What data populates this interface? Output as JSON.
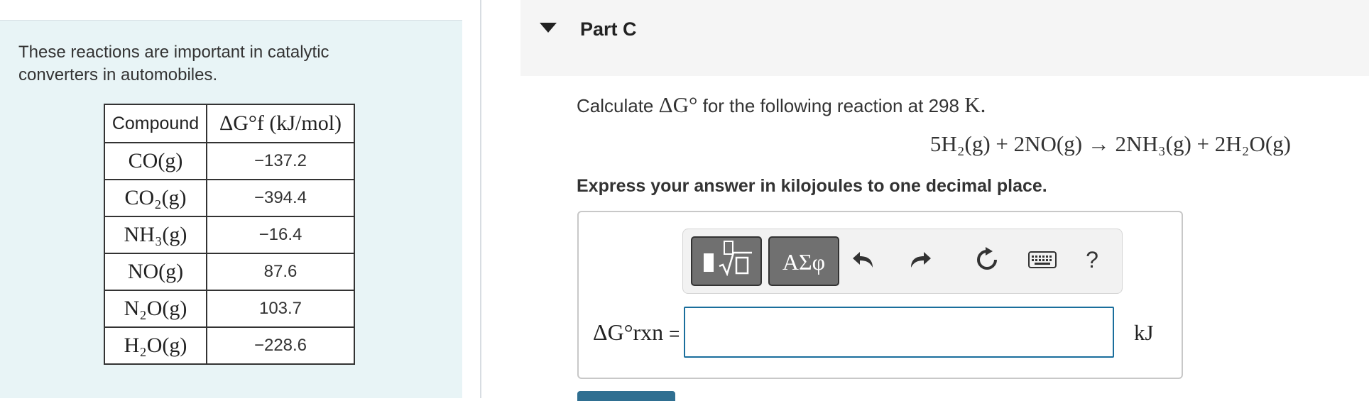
{
  "intro": {
    "line1": "These reactions are important in catalytic",
    "line2": "converters in automobiles."
  },
  "table": {
    "header_compound": "Compound",
    "header_dg": "ΔG°f (kJ/mol)",
    "rows": [
      {
        "compound": "CO(g)",
        "value": "−137.2"
      },
      {
        "compound": "CO₂(g)",
        "value": "−394.4"
      },
      {
        "compound": "NH₃(g)",
        "value": "−16.4"
      },
      {
        "compound": "NO(g)",
        "value": "87.6"
      },
      {
        "compound": "N₂O(g)",
        "value": "103.7"
      },
      {
        "compound": "H₂O(g)",
        "value": "−228.6"
      }
    ]
  },
  "part": {
    "title": "Part C",
    "question_prefix": "Calculate",
    "question_symbol": "ΔG°",
    "question_middle": "for the following reaction at 298",
    "question_unit": "K.",
    "reaction": "5H₂(g) + 2NO(g) → 2NH₃(g) + 2H₂O(g)",
    "instruction": "Express your answer in kilojoules to one decimal place."
  },
  "toolbar": {
    "greek_label": "ΑΣφ",
    "help_label": "?",
    "icons": [
      "templates-icon",
      "greek-letters-icon",
      "undo-icon",
      "redo-icon",
      "reset-icon",
      "keyboard-icon",
      "help-icon"
    ]
  },
  "answer": {
    "label": "ΔG°rxn",
    "equals": "=",
    "value": "",
    "unit": "kJ"
  },
  "colors": {
    "left_panel_bg": "#e8f4f6",
    "input_border": "#1a6e9c",
    "submit_button": "#2f6f91"
  }
}
